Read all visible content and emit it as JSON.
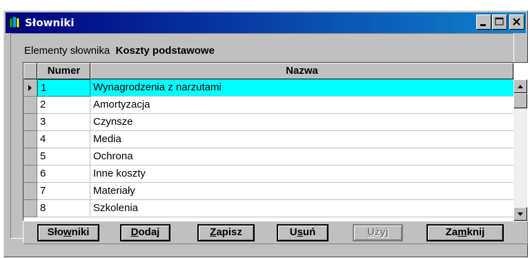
{
  "window": {
    "title": "Słowniki",
    "controls": [
      "minimize-icon",
      "maximize-icon",
      "close-icon"
    ]
  },
  "caption": {
    "label": "Elementy słownika",
    "value": "Koszty podstawowe"
  },
  "table": {
    "columns": [
      "Numer",
      "Nazwa"
    ],
    "rows": [
      {
        "numer": "1",
        "nazwa": "Wynagrodzenia z narzutami",
        "selected": true
      },
      {
        "numer": "2",
        "nazwa": "Amortyzacja"
      },
      {
        "numer": "3",
        "nazwa": "Czynsze"
      },
      {
        "numer": "4",
        "nazwa": "Media"
      },
      {
        "numer": "5",
        "nazwa": "Ochrona"
      },
      {
        "numer": "6",
        "nazwa": "Inne koszty"
      },
      {
        "numer": "7",
        "nazwa": "Materiały"
      },
      {
        "numer": "8",
        "nazwa": "Szkolenia"
      }
    ]
  },
  "buttons": {
    "slowniki": {
      "pre": "Sło",
      "key": "w",
      "post": "niki"
    },
    "dodaj": {
      "pre": "",
      "key": "D",
      "post": "odaj"
    },
    "zapisz": {
      "pre": "",
      "key": "Z",
      "post": "apisz"
    },
    "usun": {
      "pre": "U",
      "key": "s",
      "post": "uń"
    },
    "uzyj": {
      "pre": "",
      "key": "U",
      "post": "żyj",
      "disabled": true
    },
    "zamknij": {
      "pre": "Za",
      "key": "m",
      "post": "knij"
    }
  },
  "colors": {
    "titlebar": "#000080",
    "selected_row": "#00ffff",
    "face": "#c0c0c0"
  }
}
